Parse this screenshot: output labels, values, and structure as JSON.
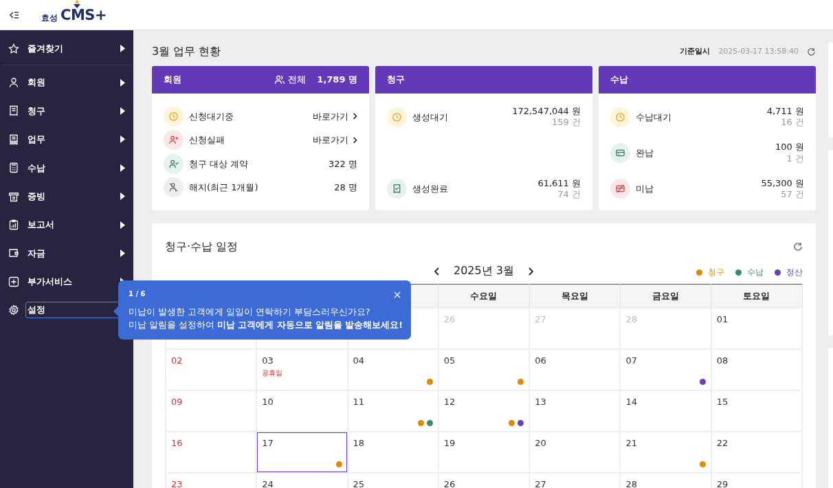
{
  "header": {
    "logo_small": "효성",
    "logo_big": "CMS+"
  },
  "sidebar": {
    "items": [
      {
        "label": "즐겨찾기",
        "kind": "group",
        "selected": false
      },
      {
        "label": "회원",
        "kind": "group",
        "selected": false
      },
      {
        "label": "청구",
        "kind": "group",
        "selected": false
      },
      {
        "label": "업무",
        "kind": "group",
        "selected": false
      },
      {
        "label": "수납",
        "kind": "group",
        "selected": false
      },
      {
        "label": "증빙",
        "kind": "group",
        "selected": false
      },
      {
        "label": "보고서",
        "kind": "group",
        "selected": false
      },
      {
        "label": "자금",
        "kind": "group",
        "selected": false
      },
      {
        "label": "부가서비스",
        "kind": "group",
        "selected": false
      },
      {
        "label": "설정",
        "kind": "page",
        "selected": true
      }
    ]
  },
  "dashboard": {
    "title": "3월 업무 현황",
    "reference_label": "기준일시",
    "reference_time": "2025-03-17 13:58:40",
    "cards": [
      {
        "title": "회원",
        "total_label": "전체",
        "total_value": "1,789 명",
        "rows": [
          {
            "kind": "link",
            "label": "신청대기중",
            "action": "바로가기"
          },
          {
            "kind": "link",
            "label": "신청실패",
            "action": "바로가기"
          },
          {
            "kind": "value",
            "label": "청구 대상 계약",
            "value": "322 명"
          },
          {
            "kind": "value",
            "label": "해지(최근 1개월)",
            "value": "28 명"
          }
        ]
      },
      {
        "title": "청구",
        "rows": [
          {
            "kind": "amount",
            "label": "생성대기",
            "amount": "172,547,044 원",
            "count": "159 건"
          },
          {
            "kind": "amount",
            "label": "생성완료",
            "amount": "61,611 원",
            "count": "74 건"
          }
        ]
      },
      {
        "title": "수납",
        "rows": [
          {
            "kind": "amount",
            "label": "수납대기",
            "amount": "4,711 원",
            "count": "16 건"
          },
          {
            "kind": "amount",
            "label": "완납",
            "amount": "100 원",
            "count": "1 건"
          },
          {
            "kind": "amount",
            "label": "미납",
            "amount": "55,300 원",
            "count": "57 건"
          }
        ]
      }
    ]
  },
  "calendar": {
    "title": "청구·수납 일정",
    "month": "2025년 3월",
    "legend": [
      {
        "label": "청구",
        "color": "#e08a00"
      },
      {
        "label": "수납",
        "color": "#3a8a78"
      },
      {
        "label": "정산",
        "color": "#6a3fc0"
      }
    ],
    "weekdays": [
      "수요일",
      "목요일",
      "금요일",
      "토요일"
    ],
    "weeks": [
      {
        "days": [
          {
            "day": "26",
            "kind": "prev",
            "selected": false
          },
          {
            "day": "27",
            "kind": "prev",
            "selected": false
          },
          {
            "day": "28",
            "kind": "prev",
            "selected": false
          },
          {
            "day": "01",
            "kind": "weekday",
            "selected": false
          }
        ]
      },
      {
        "days": [
          {
            "day": "02",
            "kind": "sunday",
            "selected": false
          },
          {
            "day": "03",
            "kind": "weekday",
            "note": "공휴일",
            "selected": false
          },
          {
            "day": "04",
            "kind": "weekday",
            "selected": false,
            "events": [
              {
                "color": "#e08a00"
              }
            ]
          },
          {
            "day": "05",
            "kind": "weekday",
            "selected": false,
            "events": [
              {
                "color": "#e08a00"
              }
            ]
          },
          {
            "day": "06",
            "kind": "weekday",
            "selected": false
          },
          {
            "day": "07",
            "kind": "weekday",
            "selected": false,
            "events": [
              {
                "color": "#6a3fc0"
              }
            ]
          },
          {
            "day": "08",
            "kind": "weekday",
            "selected": false
          }
        ]
      },
      {
        "days": [
          {
            "day": "09",
            "kind": "sunday",
            "selected": false
          },
          {
            "day": "10",
            "kind": "weekday",
            "selected": false
          },
          {
            "day": "11",
            "kind": "weekday",
            "selected": false,
            "events": [
              {
                "color": "#e08a00"
              },
              {
                "color": "#3a8a78"
              }
            ]
          },
          {
            "day": "12",
            "kind": "weekday",
            "selected": false,
            "events": [
              {
                "color": "#e08a00"
              },
              {
                "color": "#6a3fc0"
              }
            ]
          },
          {
            "day": "13",
            "kind": "weekday",
            "selected": false
          },
          {
            "day": "14",
            "kind": "weekday",
            "selected": false
          },
          {
            "day": "15",
            "kind": "weekday",
            "selected": false
          }
        ]
      },
      {
        "days": [
          {
            "day": "16",
            "kind": "sunday",
            "selected": false
          },
          {
            "day": "17",
            "kind": "weekday",
            "selected": true,
            "events": [
              {
                "color": "#e08a00"
              }
            ]
          },
          {
            "day": "18",
            "kind": "weekday",
            "selected": false
          },
          {
            "day": "19",
            "kind": "weekday",
            "selected": false
          },
          {
            "day": "20",
            "kind": "weekday",
            "selected": false
          },
          {
            "day": "21",
            "kind": "weekday",
            "selected": false,
            "events": [
              {
                "color": "#e08a00"
              }
            ]
          },
          {
            "day": "22",
            "kind": "weekday",
            "selected": false
          }
        ]
      },
      {
        "days": [
          {
            "day": "23",
            "kind": "sunday",
            "selected": false
          },
          {
            "day": "24",
            "kind": "weekday",
            "selected": false
          },
          {
            "day": "25",
            "kind": "weekday",
            "selected": false
          },
          {
            "day": "26",
            "kind": "weekday",
            "selected": false
          },
          {
            "day": "27",
            "kind": "weekday",
            "selected": false
          },
          {
            "day": "28",
            "kind": "weekday",
            "selected": false
          },
          {
            "day": "29",
            "kind": "weekday",
            "selected": false
          }
        ]
      }
    ]
  },
  "tour": {
    "step": "1 / 6",
    "lines": [
      "미납이 발생한 고객에게 일일이 연락하기 부담스러우신가요?",
      "미납 알림을 설정하여 **미납 고객에게 자동으로 알림을 발송해보세요!**"
    ]
  }
}
